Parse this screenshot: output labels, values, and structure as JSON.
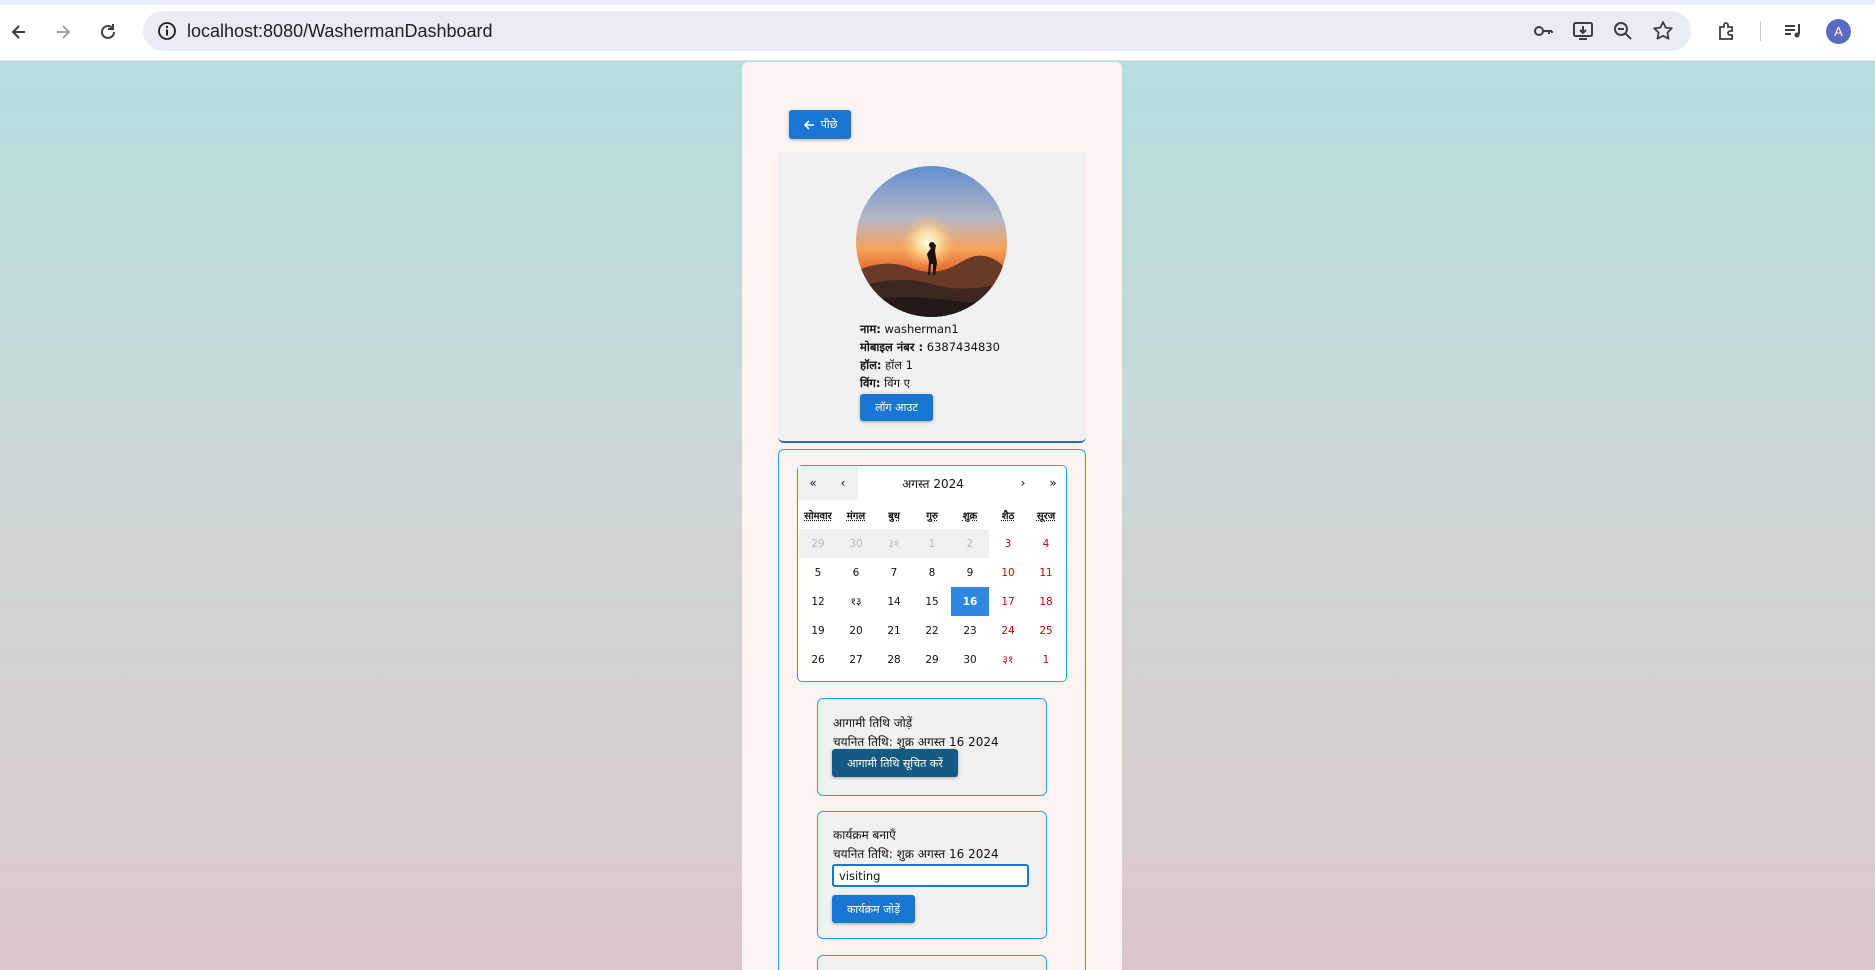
{
  "browser": {
    "url": "localhost:8080/WashermanDashboard",
    "profile_initial": "A"
  },
  "page": {
    "back_label": "पीछे",
    "profile": {
      "name_label": "नाम:",
      "name_value": "washerman1",
      "mobile_label": "मोबाइल नंबर :",
      "mobile_value": "6387434830",
      "hall_label": "हॉल:",
      "hall_value": "हॉल 1",
      "wing_label": "विंग:",
      "wing_value": "विंग ए",
      "logout_label": "लॉग आउट"
    },
    "calendar": {
      "title": "अगस्त 2024",
      "nav_prev2": "«",
      "nav_prev": "‹",
      "nav_next": "›",
      "nav_next2": "»",
      "weekdays": [
        "सोमवार",
        "मंगल",
        "बुध",
        "गुरु",
        "शुक्र",
        "शैठ",
        "सूरज"
      ],
      "weeks": [
        [
          {
            "d": "29",
            "s": "muted"
          },
          {
            "d": "30",
            "s": "muted"
          },
          {
            "d": "३१",
            "s": "muted"
          },
          {
            "d": "1",
            "s": "muted"
          },
          {
            "d": "2",
            "s": "muted"
          },
          {
            "d": "3",
            "s": "weekend"
          },
          {
            "d": "4",
            "s": "weekend"
          }
        ],
        [
          {
            "d": "5",
            "s": ""
          },
          {
            "d": "6",
            "s": ""
          },
          {
            "d": "7",
            "s": ""
          },
          {
            "d": "8",
            "s": ""
          },
          {
            "d": "9",
            "s": ""
          },
          {
            "d": "10",
            "s": "weekend"
          },
          {
            "d": "11",
            "s": "weekend"
          }
        ],
        [
          {
            "d": "12",
            "s": ""
          },
          {
            "d": "१३",
            "s": ""
          },
          {
            "d": "14",
            "s": ""
          },
          {
            "d": "15",
            "s": ""
          },
          {
            "d": "16",
            "s": "selected"
          },
          {
            "d": "17",
            "s": "weekend"
          },
          {
            "d": "18",
            "s": "weekend"
          }
        ],
        [
          {
            "d": "19",
            "s": ""
          },
          {
            "d": "20",
            "s": ""
          },
          {
            "d": "21",
            "s": ""
          },
          {
            "d": "22",
            "s": ""
          },
          {
            "d": "23",
            "s": ""
          },
          {
            "d": "24",
            "s": "weekend"
          },
          {
            "d": "25",
            "s": "weekend"
          }
        ],
        [
          {
            "d": "26",
            "s": ""
          },
          {
            "d": "27",
            "s": ""
          },
          {
            "d": "28",
            "s": ""
          },
          {
            "d": "29",
            "s": ""
          },
          {
            "d": "30",
            "s": ""
          },
          {
            "d": "३१",
            "s": "weekend"
          },
          {
            "d": "1",
            "s": "weekend-muted"
          }
        ]
      ]
    },
    "upcoming": {
      "heading": "आगामी तिथि जोड़ें",
      "selected_date": "चयनित तिथि: शुक्र अगस्त 16 2024",
      "button_label": "आगामी तिथि सूचित करें"
    },
    "event": {
      "heading": "कार्यक्रम बनाएँ",
      "selected_date": "चयनित तिथि: शुक्र अगस्त 16 2024",
      "input_value": "visiting",
      "button_label": "कार्यक्रम जोड़ें"
    },
    "colors": {
      "primary": "#1976d2",
      "accent_border": "#29a3e0",
      "weekend": "#d10000",
      "selected_day": "#2f87e0",
      "notify_button": "#145a82"
    }
  }
}
